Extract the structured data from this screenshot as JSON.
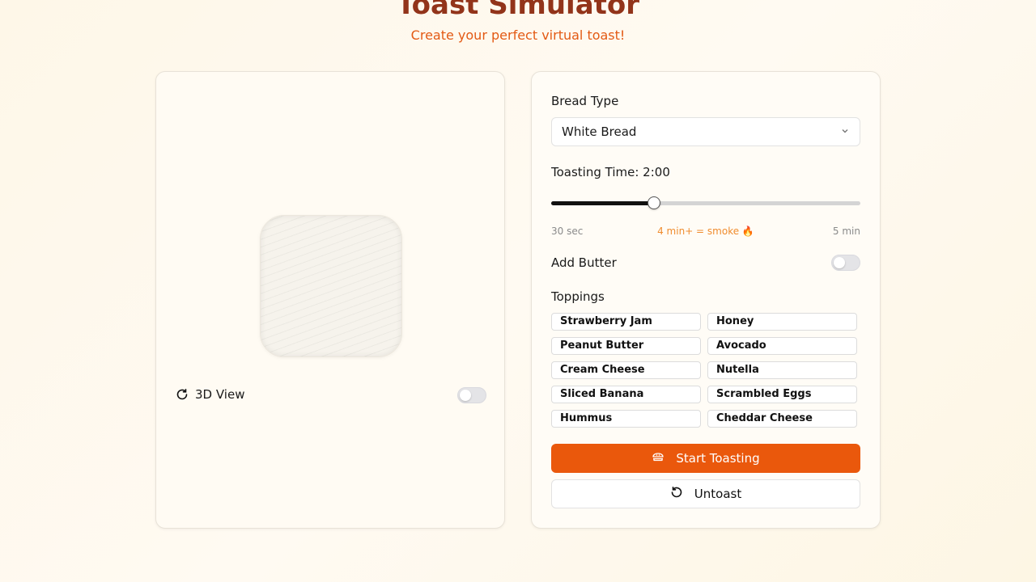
{
  "header": {
    "title": "Toast Simulator",
    "subtitle": "Create your perfect virtual toast!"
  },
  "preview": {
    "view_label": "3D View",
    "view_enabled": false
  },
  "controls": {
    "bread_type_label": "Bread Type",
    "bread_type_value": "White Bread",
    "toasting_time_label": "Toasting Time: 2:00",
    "toasting_time_seconds": 120,
    "toasting_min_seconds": 30,
    "toasting_max_seconds": 300,
    "scale_min": "30 sec",
    "scale_warning": "4 min+ = smoke 🔥",
    "scale_max": "5 min",
    "butter_label": "Add Butter",
    "butter_enabled": false,
    "toppings_label": "Toppings",
    "toppings": [
      "Strawberry Jam",
      "Honey",
      "Peanut Butter",
      "Avocado",
      "Cream Cheese",
      "Nutella",
      "Sliced Banana",
      "Scrambled Eggs",
      "Hummus",
      "Cheddar Cheese"
    ],
    "start_button": "Start Toasting",
    "untoast_button": "Untoast"
  },
  "colors": {
    "accent": "#ea580c",
    "title": "#92341a",
    "warning": "#f08c2e"
  }
}
